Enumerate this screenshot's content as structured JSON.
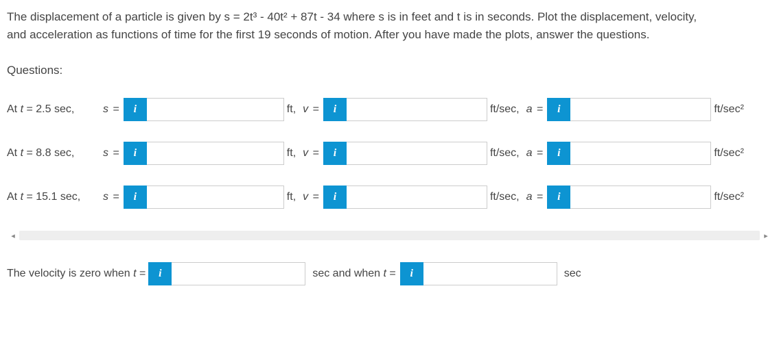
{
  "problem": {
    "line1": "The displacement of a particle is given by s = 2t³ - 40t² + 87t - 34 where s is in feet and t is in seconds. Plot the displacement, velocity,",
    "line2": "and acceleration as functions of time for the first 19 seconds of motion. After you have made the plots, answer the questions."
  },
  "questions_heading": "Questions:",
  "rows": [
    {
      "time_prefix": "At ",
      "time_var": "t",
      "time_eq": " = ",
      "time_val": "2.5 sec,",
      "s_label": "s",
      "eq": " = ",
      "ft": "ft, ",
      "v_label": "v",
      "ftsec": "ft/sec, ",
      "a_label": "a",
      "ftsec2": "ft/sec²"
    },
    {
      "time_prefix": "At ",
      "time_var": "t",
      "time_eq": " = ",
      "time_val": "8.8 sec,",
      "s_label": "s",
      "eq": " = ",
      "ft": "ft, ",
      "v_label": "v",
      "ftsec": "ft/sec, ",
      "a_label": "a",
      "ftsec2": "ft/sec²"
    },
    {
      "time_prefix": "At ",
      "time_var": "t",
      "time_eq": " = ",
      "time_val": "15.1 sec,",
      "s_label": "s",
      "eq": " = ",
      "ft": "ft, ",
      "v_label": "v",
      "ftsec": "ft/sec, ",
      "a_label": "a",
      "ftsec2": "ft/sec²"
    }
  ],
  "info_glyph": "i",
  "velocity_zero": {
    "pre": "The velocity is zero when ",
    "t": "t",
    "eq": " = ",
    "mid": "sec and when ",
    "t2": "t",
    "eq2": " = ",
    "end": "sec"
  },
  "scroll": {
    "left": "◂",
    "right": "▸"
  }
}
